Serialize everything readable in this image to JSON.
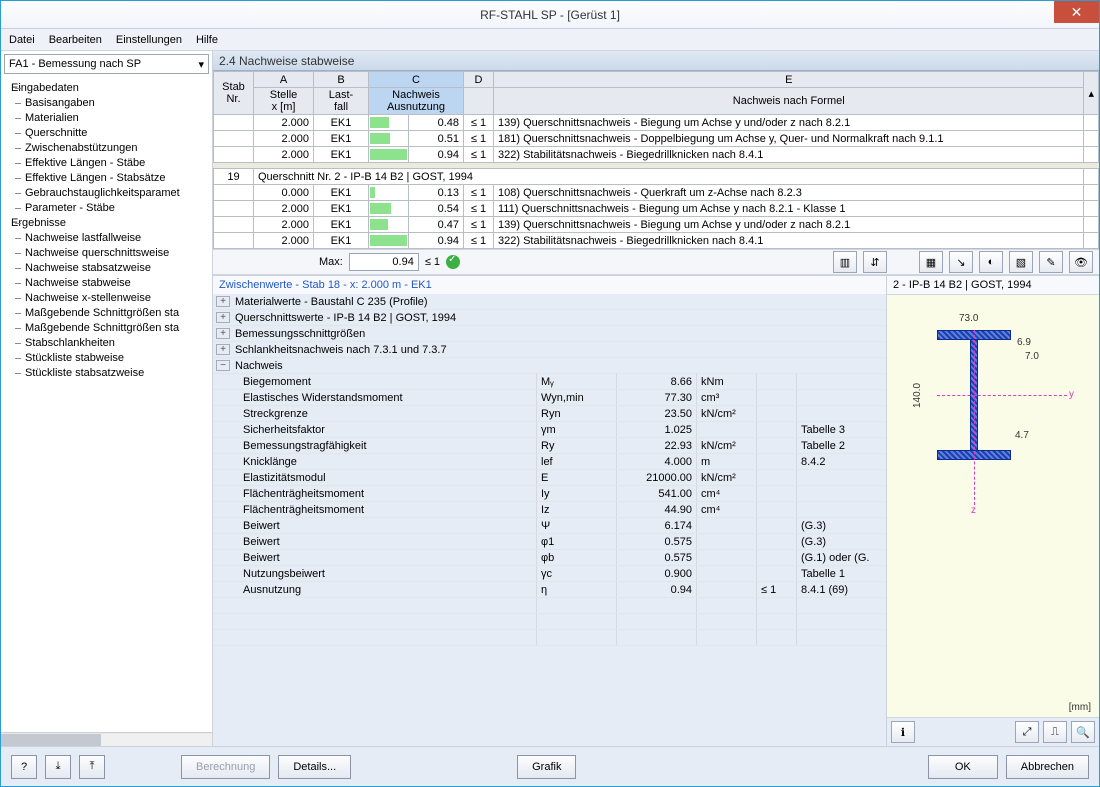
{
  "title": "RF-STAHL SP - [Gerüst 1]",
  "menu": [
    "Datei",
    "Bearbeiten",
    "Einstellungen",
    "Hilfe"
  ],
  "combo": "FA1 - Bemessung nach SP",
  "tree": {
    "group1": "Eingabedaten",
    "items1": [
      "Basisangaben",
      "Materialien",
      "Querschnitte",
      "Zwischenabstützungen",
      "Effektive Längen - Stäbe",
      "Effektive Längen - Stabsätze",
      "Gebrauchstauglichkeitsparamet",
      "Parameter - Stäbe"
    ],
    "group2": "Ergebnisse",
    "items2": [
      "Nachweise lastfallweise",
      "Nachweise querschnittsweise",
      "Nachweise stabsatzweise",
      "Nachweise stabweise",
      "Nachweise x-stellenweise",
      "Maßgebende Schnittgrößen sta",
      "Maßgebende Schnittgrößen sta",
      "Stabschlankheiten",
      "Stückliste stabweise",
      "Stückliste stabsatzweise"
    ]
  },
  "section_title": "2.4 Nachweise stabweise",
  "cols": {
    "stab": "Stab\nNr.",
    "A": "A",
    "B": "B",
    "C": "C",
    "D": "D",
    "E": "E",
    "stelle": "Stelle\nx [m]",
    "lastfall": "Last-\nfall",
    "nachweis": "Nachweis\nAusnutzung",
    "formel": "Nachweis nach Formel"
  },
  "top_rows": [
    {
      "x": "2.000",
      "lf": "EK1",
      "bar": 0.48,
      "val": "0.48",
      "rel": "≤ 1",
      "txt": "139) Querschnittsnachweis - Biegung um Achse y und/oder z nach 8.2.1"
    },
    {
      "x": "2.000",
      "lf": "EK1",
      "bar": 0.51,
      "val": "0.51",
      "rel": "≤ 1",
      "txt": "181) Querschnittsnachweis - Doppelbiegung um Achse y, Quer- und Normalkraft nach 9.1.1"
    },
    {
      "x": "2.000",
      "lf": "EK1",
      "bar": 0.94,
      "val": "0.94",
      "rel": "≤ 1",
      "txt": "322) Stabilitätsnachweis -  Biegedrillknicken nach 8.4.1",
      "sel": true
    }
  ],
  "section_row": {
    "num": "19",
    "label": "Querschnitt Nr.  2 - IP-B 14 B2 | GOST, 1994"
  },
  "bot_rows": [
    {
      "x": "0.000",
      "lf": "EK1",
      "bar": 0.13,
      "val": "0.13",
      "rel": "≤ 1",
      "txt": "108) Querschnittsnachweis - Querkraft um z-Achse nach 8.2.3"
    },
    {
      "x": "2.000",
      "lf": "EK1",
      "bar": 0.54,
      "val": "0.54",
      "rel": "≤ 1",
      "txt": "111) Querschnittsnachweis - Biegung um Achse y nach 8.2.1 - Klasse 1"
    },
    {
      "x": "2.000",
      "lf": "EK1",
      "bar": 0.47,
      "val": "0.47",
      "rel": "≤ 1",
      "txt": "139) Querschnittsnachweis - Biegung um Achse y und/oder z nach 8.2.1"
    },
    {
      "x": "2.000",
      "lf": "EK1",
      "bar": 0.94,
      "val": "0.94",
      "rel": "≤ 1",
      "txt": "322) Stabilitätsnachweis -  Biegedrillknicken nach 8.4.1"
    }
  ],
  "max_label": "Max:",
  "max_val": "0.94",
  "max_rel": "≤ 1",
  "details_header": "Zwischenwerte - Stab 18 - x: 2.000 m - EK1",
  "detail_groups": [
    "Materialwerte - Baustahl C 235 (Profile)",
    "Querschnittswerte  -  IP-B 14 B2 | GOST, 1994",
    "Bemessungsschnittgrößen",
    "Schlankheitsnachweis nach 7.3.1 und 7.3.7"
  ],
  "nachweis_label": "Nachweis",
  "detail_rows": [
    {
      "lbl": "Biegemoment",
      "sym": "Mᵧ",
      "val": "8.66",
      "unit": "kNm",
      "cmp": "",
      "ref": ""
    },
    {
      "lbl": "Elastisches Widerstandsmoment",
      "sym": "Wyn,min",
      "val": "77.30",
      "unit": "cm³",
      "cmp": "",
      "ref": ""
    },
    {
      "lbl": "Streckgrenze",
      "sym": "Ryn",
      "val": "23.50",
      "unit": "kN/cm²",
      "cmp": "",
      "ref": ""
    },
    {
      "lbl": "Sicherheitsfaktor",
      "sym": "γm",
      "val": "1.025",
      "unit": "",
      "cmp": "",
      "ref": "Tabelle 3"
    },
    {
      "lbl": "Bemessungstragfähigkeit",
      "sym": "Ry",
      "val": "22.93",
      "unit": "kN/cm²",
      "cmp": "",
      "ref": "Tabelle 2"
    },
    {
      "lbl": "Knicklänge",
      "sym": "lef",
      "val": "4.000",
      "unit": "m",
      "cmp": "",
      "ref": "8.4.2"
    },
    {
      "lbl": "Elastizitätsmodul",
      "sym": "E",
      "val": "21000.00",
      "unit": "kN/cm²",
      "cmp": "",
      "ref": ""
    },
    {
      "lbl": "Flächenträgheitsmoment",
      "sym": "Iy",
      "val": "541.00",
      "unit": "cm⁴",
      "cmp": "",
      "ref": ""
    },
    {
      "lbl": "Flächenträgheitsmoment",
      "sym": "Iz",
      "val": "44.90",
      "unit": "cm⁴",
      "cmp": "",
      "ref": ""
    },
    {
      "lbl": "Beiwert",
      "sym": "Ψ",
      "val": "6.174",
      "unit": "",
      "cmp": "",
      "ref": "(G.3)"
    },
    {
      "lbl": "Beiwert",
      "sym": "φ1",
      "val": "0.575",
      "unit": "",
      "cmp": "",
      "ref": "(G.3)"
    },
    {
      "lbl": "Beiwert",
      "sym": "φb",
      "val": "0.575",
      "unit": "",
      "cmp": "",
      "ref": "(G.1) oder (G."
    },
    {
      "lbl": "Nutzungsbeiwert",
      "sym": "γc",
      "val": "0.900",
      "unit": "",
      "cmp": "",
      "ref": "Tabelle 1"
    },
    {
      "lbl": "Ausnutzung",
      "sym": "η",
      "val": "0.94",
      "unit": "",
      "cmp": "≤ 1",
      "ref": "8.4.1 (69)"
    }
  ],
  "profile_title": "2 - IP-B 14 B2 | GOST, 1994",
  "profile_dims": {
    "width": "73.0",
    "height": "140.0",
    "tf": "6.9",
    "tw": "7.0",
    "r": "4.7"
  },
  "profile_unit": "[mm]",
  "footer": {
    "berechnung": "Berechnung",
    "details": "Details...",
    "grafik": "Grafik",
    "ok": "OK",
    "cancel": "Abbrechen"
  }
}
